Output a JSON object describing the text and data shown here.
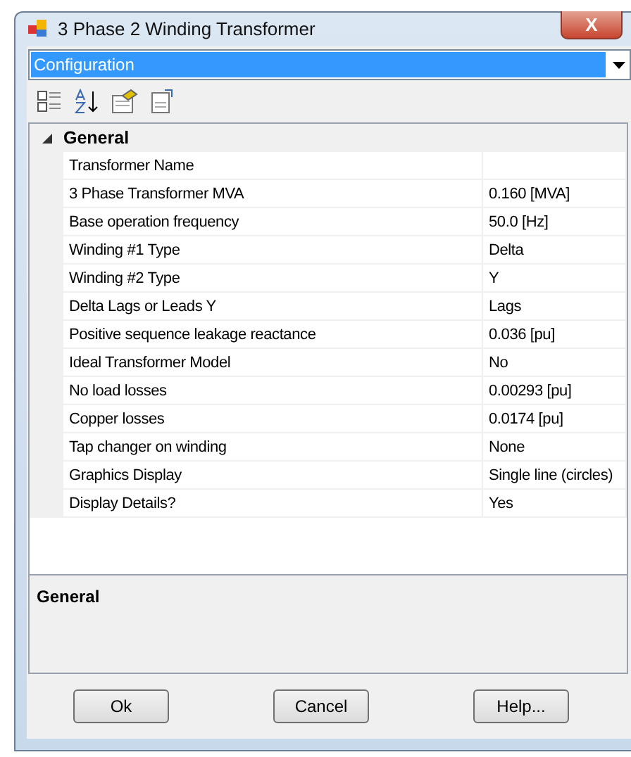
{
  "window": {
    "title": "3 Phase 2 Winding Transformer",
    "close": "X"
  },
  "object_selector": {
    "value": "Configuration"
  },
  "categories": [
    {
      "name": "General",
      "expanded": true,
      "properties": [
        {
          "name": "Transformer Name"
        },
        {
          "name": "3 Phase Transformer MVA",
          "value": "0.160 [MVA]"
        },
        {
          "name": "Base operation frequency",
          "value": "50.0 [Hz]"
        },
        {
          "name": "Winding #1 Type",
          "value": "Delta"
        },
        {
          "name": "Winding #2 Type",
          "value": "Y"
        },
        {
          "name": "Delta Lags or Leads Y",
          "value": "Lags"
        },
        {
          "name": "Positive sequence leakage reactance",
          "value": "0.036 [pu]"
        },
        {
          "name": "Ideal Transformer Model",
          "value": "No"
        },
        {
          "name": "No load losses",
          "value": "0.00293 [pu]"
        },
        {
          "name": "Copper losses",
          "value": "0.0174 [pu]"
        },
        {
          "name": "Tap changer on winding",
          "value": "None"
        },
        {
          "name": "Graphics Display",
          "value": "Single line (circles)"
        },
        {
          "name": "Display Details?",
          "value": "Yes"
        }
      ]
    }
  ],
  "description": {
    "title": "General"
  },
  "buttons": [
    "Ok",
    "Cancel",
    "Help..."
  ]
}
